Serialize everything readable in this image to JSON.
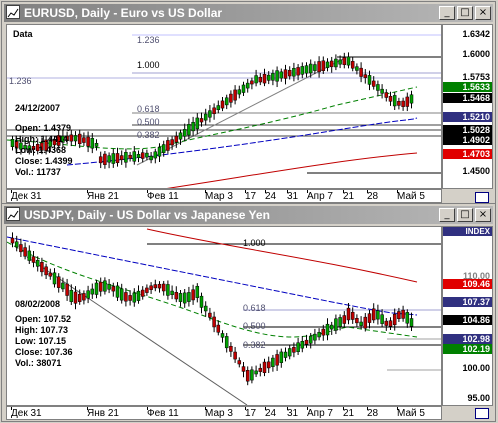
{
  "windows": [
    {
      "title": "EURUSD, Daily - Euro vs US Dollar",
      "data_label": "Data",
      "date": "24/12/2007",
      "open": "Open: 1.4379",
      "high": "High: 1.4414",
      "low": "Low: 1.4368",
      "close": "Close: 1.4399",
      "volume": "Vol.: 11737",
      "fib_labels": [
        "1.236",
        "1.000",
        "1.236",
        "0.618",
        "0.500",
        "0.382"
      ],
      "price_labels": [
        "1.6342",
        "1.6000",
        "1.5753",
        "1.5633",
        "1.5468",
        "1.5210",
        "1.5028",
        "1.4902",
        "1.4703",
        "1.4500"
      ],
      "current_price": "1.5468",
      "x_labels": [
        "Дек 31",
        "Янв 21",
        "Фев 11",
        "Мар 3",
        "17",
        "24",
        "31",
        "Апр 7",
        "21",
        "28",
        "Май 5"
      ]
    },
    {
      "title": "USDJPY, Daily - US Dollar vs Japanese Yen",
      "data_label": "INDEX",
      "date": "08/02/2008",
      "open": "Open: 107.52",
      "high": "High: 107.73",
      "low": "Low: 107.15",
      "close": "Close: 107.36",
      "volume": "Vol.: 38071",
      "fib_labels": [
        "1.000",
        "0.618",
        "0.500",
        "0.382"
      ],
      "price_labels": [
        "110.00",
        "109.46",
        "107.37",
        "104.86",
        "102.98",
        "102.19",
        "100.00",
        "95.00"
      ],
      "current_price": "104.86",
      "x_labels": [
        "Дек 31",
        "Янв 21",
        "Фев 11",
        "Мар 3",
        "17",
        "24",
        "31",
        "Апр 7",
        "21",
        "28",
        "Май 5"
      ]
    }
  ],
  "buttons": {
    "minimize": "_",
    "maximize": "□",
    "close": "×"
  },
  "colors": {
    "bull": "#00a000",
    "bear": "#c00000",
    "ma_green": "#008000",
    "ma_blue": "#0000c0",
    "ma_red": "#c00000",
    "tag_green": "#008000",
    "tag_red": "#e00000",
    "tag_blue": "#303080",
    "tag_black": "#000000"
  }
}
